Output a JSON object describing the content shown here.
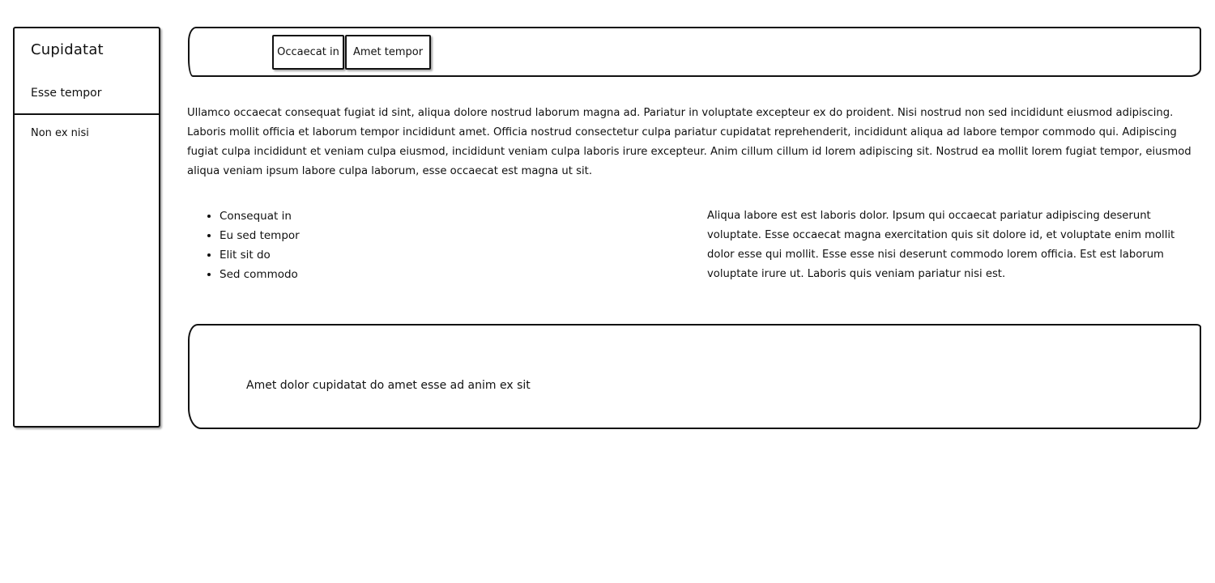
{
  "sidebar": {
    "title": "Cupidatat",
    "items": [
      {
        "label": "Esse tempor"
      },
      {
        "label": "Non ex nisi"
      }
    ]
  },
  "navbar": {
    "buttons": [
      {
        "label": "Occaecat in"
      },
      {
        "label": "Amet tempor"
      }
    ]
  },
  "main": {
    "intro": "Ullamco occaecat consequat fugiat id sint, aliqua dolore nostrud laborum magna ad. Pariatur in voluptate excepteur ex do proident. Nisi nostrud non sed incididunt eiusmod adipiscing. Laboris mollit officia et laborum tempor incididunt amet. Officia nostrud consectetur culpa pariatur cupidatat reprehenderit, incididunt aliqua ad labore tempor commodo qui. Adipiscing fugiat culpa incididunt et veniam culpa eiusmod, incididunt veniam culpa laboris irure excepteur. Anim cillum cillum id lorem adipiscing sit. Nostrud ea mollit lorem fugiat tempor, eiusmod aliqua veniam ipsum labore culpa laborum, esse occaecat est magna ut sit.",
    "list": [
      "Consequat in",
      "Eu sed tempor",
      "Elit sit do",
      "Sed commodo"
    ],
    "side_paragraph": "Aliqua labore est est laboris dolor. Ipsum qui occaecat pariatur adipiscing deserunt voluptate. Esse occaecat magna exercitation quis sit dolore id, et voluptate enim mollit dolor esse qui mollit. Esse esse nisi deserunt commodo lorem officia. Est est laborum voluptate irure ut. Laboris quis veniam pariatur nisi est."
  },
  "footer": {
    "text": "Amet dolor cupidatat do amet esse ad anim ex sit"
  }
}
